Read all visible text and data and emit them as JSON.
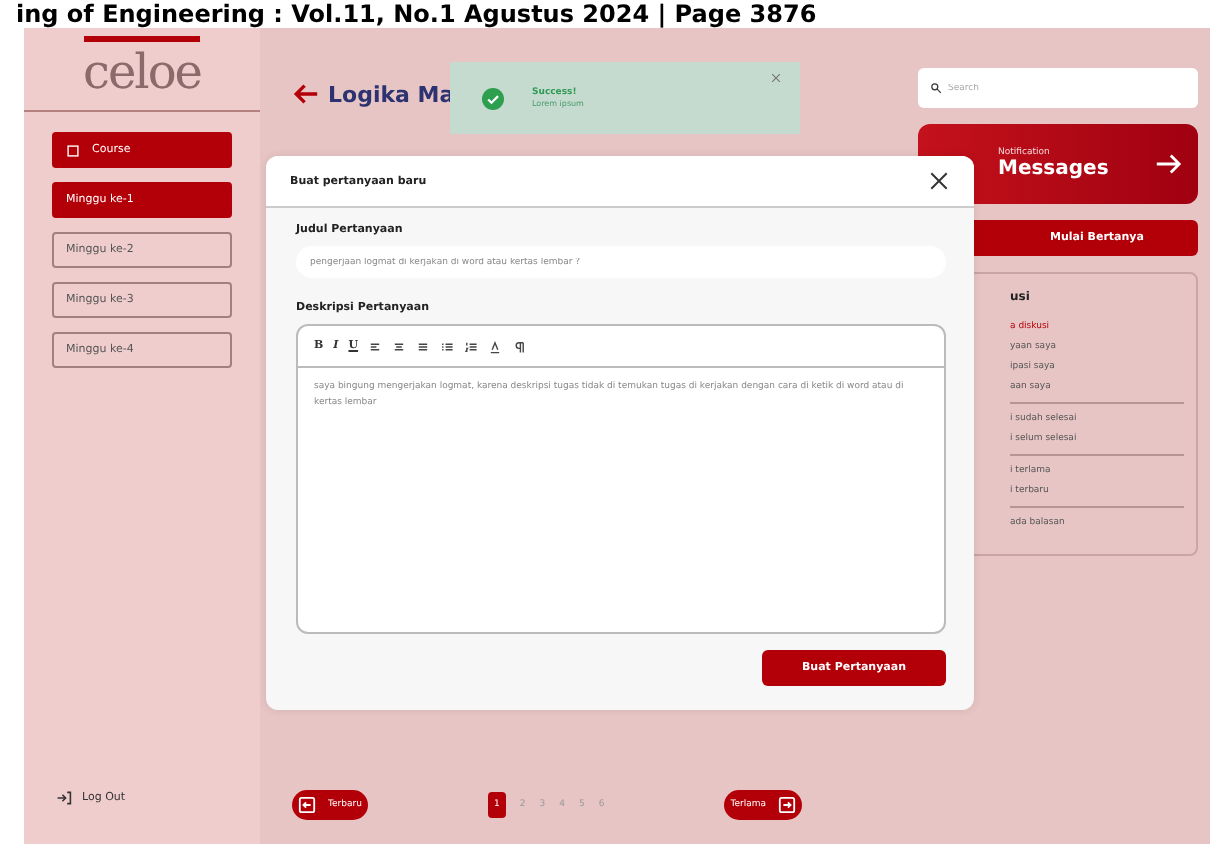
{
  "page_header": "ing of Engineering : Vol.11, No.1 Agustus 2024 | Page 3876",
  "sidebar": {
    "logo": "celoe",
    "section": {
      "label": "Course"
    },
    "weeks": [
      {
        "label": "Minggu ke-1",
        "selected": true
      },
      {
        "label": "Minggu ke-2",
        "selected": false
      },
      {
        "label": "Minggu ke-3",
        "selected": false
      },
      {
        "label": "Minggu ke-4",
        "selected": false
      }
    ],
    "logout": "Log Out"
  },
  "main": {
    "title": "Logika Ma",
    "search": {
      "placeholder": "Search"
    },
    "notification": {
      "caption": "Notification",
      "title": "Messages"
    },
    "ask_button": "Mulai Bertanya",
    "filter_panel": {
      "heading": "usi",
      "groups": [
        [
          {
            "label": "a diskusi",
            "selected": true
          },
          {
            "label": "yaan saya",
            "selected": false
          },
          {
            "label": "ipasi saya",
            "selected": false
          },
          {
            "label": "aan saya",
            "selected": false
          }
        ],
        [
          {
            "label": "i sudah selesai",
            "selected": false
          },
          {
            "label": "i selum selesai",
            "selected": false
          }
        ],
        [
          {
            "label": "i terlama",
            "selected": false
          },
          {
            "label": "i terbaru",
            "selected": false
          }
        ],
        [
          {
            "label": "ada balasan",
            "selected": false
          }
        ]
      ]
    },
    "pager": {
      "prev": "Terbaru",
      "next": "Terlama",
      "pages": [
        {
          "label": "1",
          "selected": true
        },
        {
          "label": "2",
          "selected": false
        },
        {
          "label": "3",
          "selected": false
        },
        {
          "label": "4",
          "selected": false
        },
        {
          "label": "5",
          "selected": false
        },
        {
          "label": "6",
          "selected": false
        }
      ]
    }
  },
  "toast": {
    "title": "Success!",
    "message": "Lorem ipsum"
  },
  "modal": {
    "title": "Buat pertanyaan baru",
    "title_label": "Judul Pertanyaan",
    "title_value": "pengerjaan logmat di kerjakan di word atau kertas lembar ?",
    "description_label": "Deskripsi Pertanyaan",
    "toolbar": [
      "B",
      "I",
      "U"
    ],
    "description_value": "saya bingung mengerjakan logmat, karena deskripsi tugas tidak di temukan tugas di kerjakan dengan cara di ketik di word atau di kertas lembar",
    "submit": "Buat Pertanyaan"
  }
}
